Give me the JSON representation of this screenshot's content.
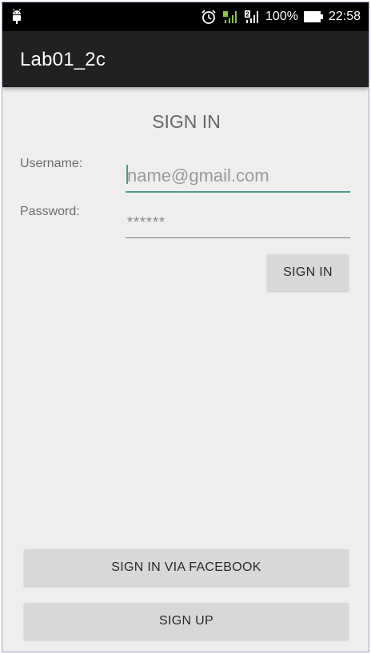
{
  "status_bar": {
    "battery_percent": "100%",
    "time": "22:58",
    "icons": [
      "android-icon",
      "alarm-icon",
      "signal-sim1-icon",
      "signal-sim2-icon",
      "battery-icon"
    ],
    "sim2_label": "2"
  },
  "app_bar": {
    "title": "Lab01_2c"
  },
  "form": {
    "heading": "SIGN IN",
    "username_label": "Username:",
    "username_placeholder": "name@gmail.com",
    "password_label": "Password:",
    "password_value": "******",
    "signin_label": "SIGN IN"
  },
  "bottom": {
    "facebook_label": "SIGN IN VIA FACEBOOK",
    "signup_label": "SIGN UP"
  },
  "colors": {
    "accent": "#4f9c8f",
    "app_bar": "#212121",
    "status_bar": "#000000",
    "background": "#eeeeee",
    "button": "#d8d8d8",
    "signal_green": "#8bc34a"
  }
}
